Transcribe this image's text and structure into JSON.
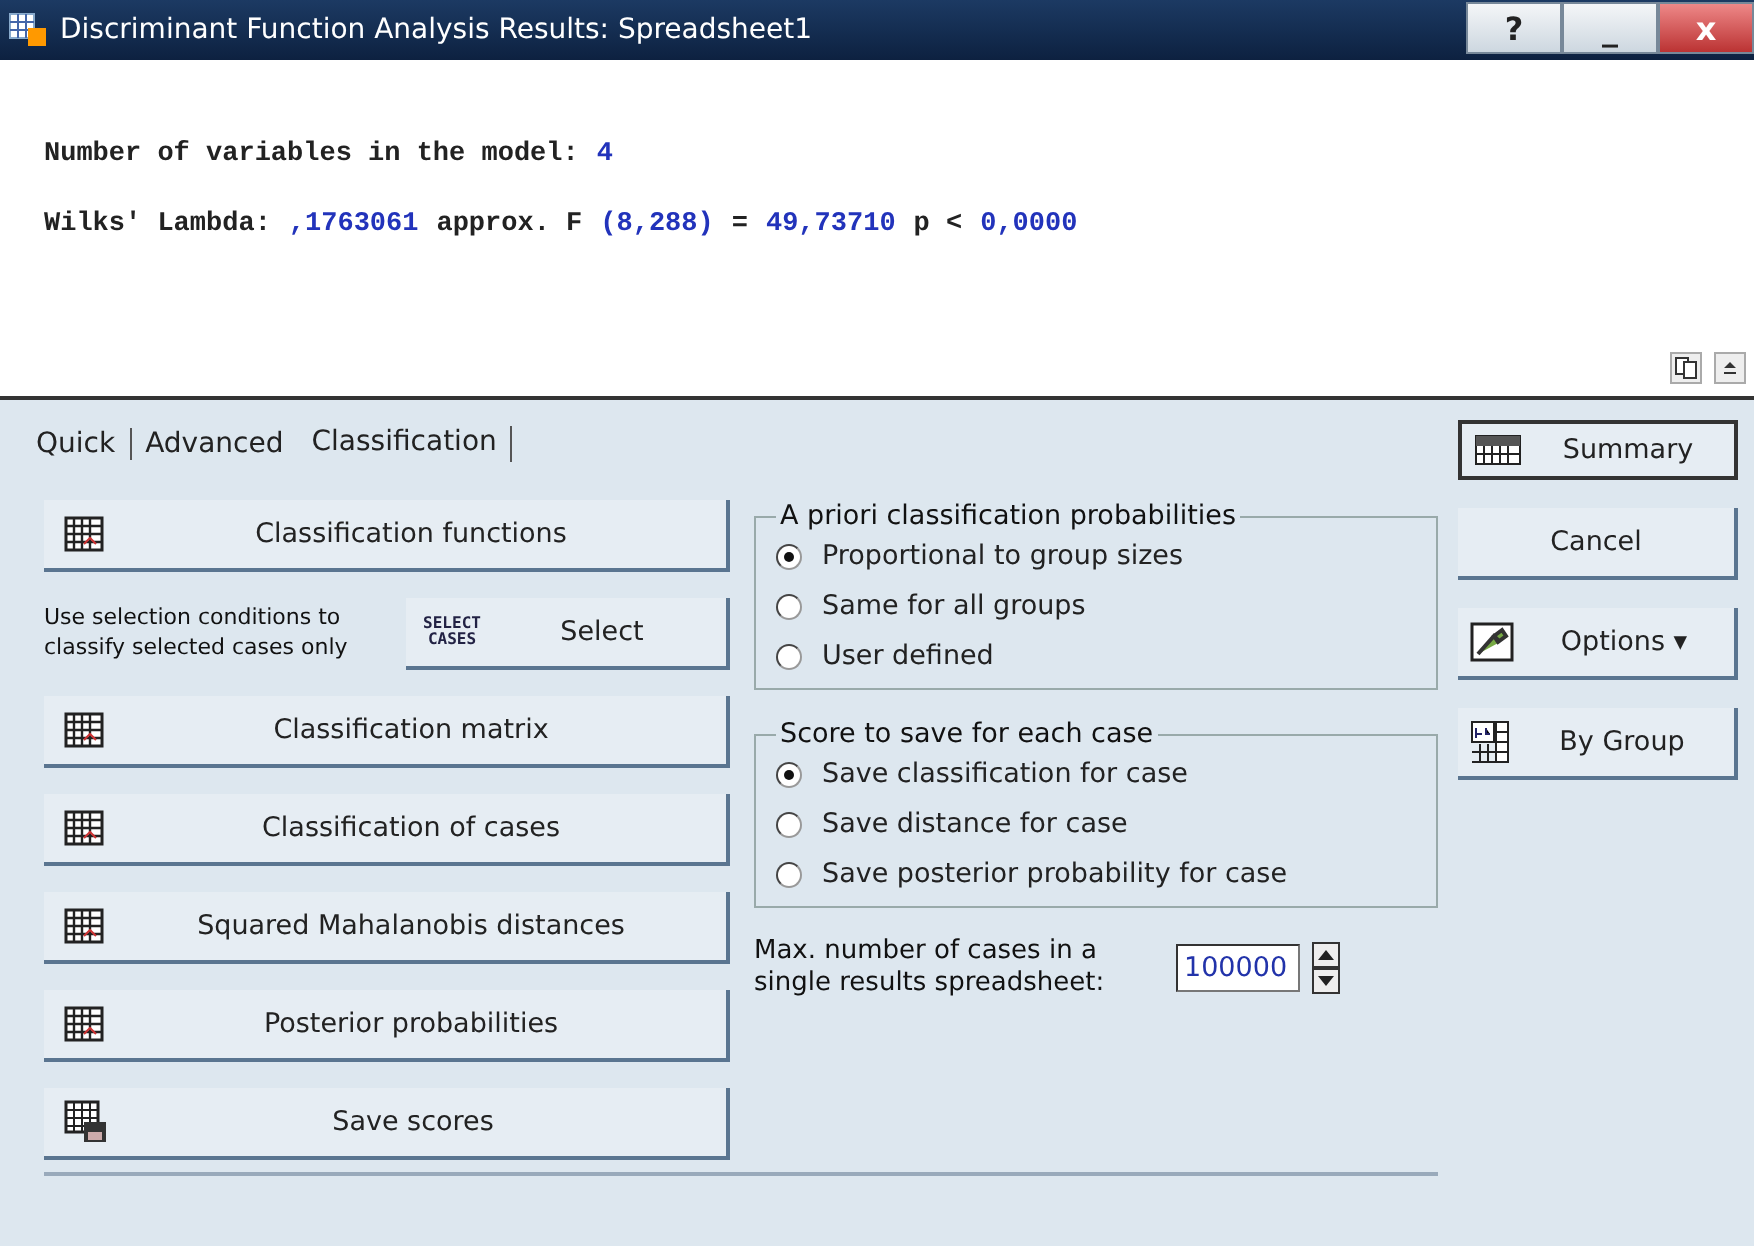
{
  "window": {
    "title": "Discriminant Function Analysis Results: Spreadsheet1",
    "controls": [
      "?",
      "_",
      "x"
    ]
  },
  "results": {
    "lines": [
      [
        {
          "kind": "label",
          "text": "Number of variables in the model:"
        },
        {
          "kind": "value",
          "text": "4"
        }
      ],
      [
        {
          "kind": "label",
          "text": "Wilks' Lambda:"
        },
        {
          "kind": "value",
          "text": ",1763061"
        },
        {
          "kind": "label",
          "text": "approx. F"
        },
        {
          "kind": "value",
          "text": "(8,288)"
        },
        {
          "kind": "label",
          "text": "="
        },
        {
          "kind": "value",
          "text": "49,73710"
        },
        {
          "kind": "label",
          "text": "p <"
        },
        {
          "kind": "value",
          "text": "0,0000"
        }
      ]
    ]
  },
  "tabs": [
    {
      "label": "Quick",
      "selected": false
    },
    {
      "label": "Advanced",
      "selected": false
    },
    {
      "label": "Classification",
      "selected": true
    }
  ],
  "left_buttons": [
    {
      "kind": "table",
      "label": "Classification functions"
    },
    {
      "kind": "select",
      "note": "Use selection conditions to classify selected cases only",
      "icon_text": "SELECT CASES",
      "label": "Select"
    },
    {
      "kind": "table",
      "label": "Classification matrix"
    },
    {
      "kind": "table",
      "label": "Classification of cases"
    },
    {
      "kind": "table",
      "label": "Squared Mahalanobis distances"
    },
    {
      "kind": "table",
      "label": "Posterior probabilities"
    },
    {
      "kind": "save",
      "label": "Save scores"
    }
  ],
  "groups": [
    {
      "title": "A priori classification probabilities",
      "options": [
        {
          "label": "Proportional to group sizes",
          "selected": true
        },
        {
          "label": "Same for all groups",
          "selected": false
        },
        {
          "label": "User defined",
          "selected": false
        }
      ]
    },
    {
      "title": "Score to save for each case",
      "options": [
        {
          "label": "Save classification for case",
          "selected": true
        },
        {
          "label": "Save distance for case",
          "selected": false
        },
        {
          "label": "Save posterior probability for case",
          "selected": false
        }
      ]
    }
  ],
  "max_cases": {
    "label": "Max. number of cases in a single results spreadsheet:",
    "value": "100000"
  },
  "right_buttons": [
    {
      "kind": "summary",
      "label": "Summary"
    },
    {
      "kind": "plain",
      "label": "Cancel"
    },
    {
      "kind": "options",
      "label": "Options ▾"
    },
    {
      "kind": "bygroup",
      "label": "By Group"
    }
  ]
}
